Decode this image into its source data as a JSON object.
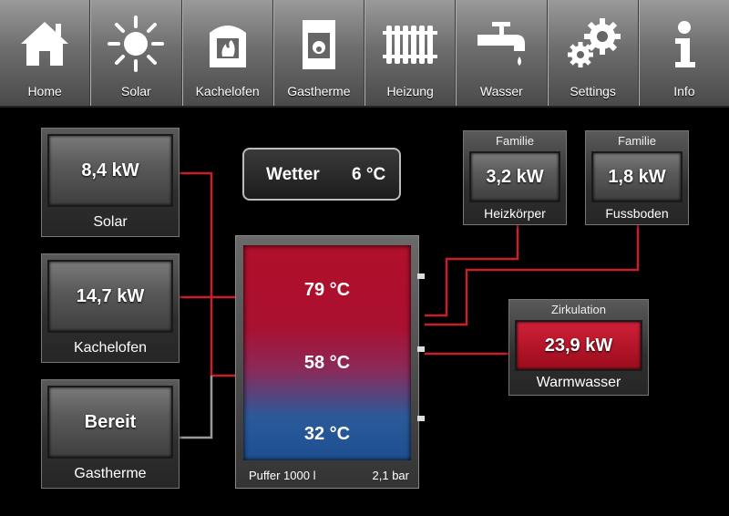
{
  "nav": {
    "home": "Home",
    "solar": "Solar",
    "kachelofen": "Kachelofen",
    "gastherme": "Gastherme",
    "heizung": "Heizung",
    "wasser": "Wasser",
    "settings": "Settings",
    "info": "Info"
  },
  "sources": {
    "solar": {
      "value": "8,4 kW",
      "label": "Solar"
    },
    "kachelofen": {
      "value": "14,7 kW",
      "label": "Kachelofen"
    },
    "gastherme": {
      "value": "Bereit",
      "label": "Gastherme"
    }
  },
  "wetter": {
    "label": "Wetter",
    "value": "6 °C"
  },
  "consumers": {
    "heizkoerper": {
      "group": "Familie",
      "value": "3,2 kW",
      "label": "Heizkörper"
    },
    "fussboden": {
      "group": "Familie",
      "value": "1,8 kW",
      "label": "Fussboden"
    },
    "warmwasser": {
      "group": "Zirkulation",
      "value": "23,9 kW",
      "label": "Warmwasser"
    }
  },
  "puffer": {
    "temp_top": "79 °C",
    "temp_mid": "58 °C",
    "temp_bottom": "32 °C",
    "name": "Puffer 1000 l",
    "pressure": "2,1 bar"
  },
  "colors": {
    "line_hot": "#c8202a",
    "line_cold": "#9a9a9a",
    "warm_screen": "#b01020"
  }
}
